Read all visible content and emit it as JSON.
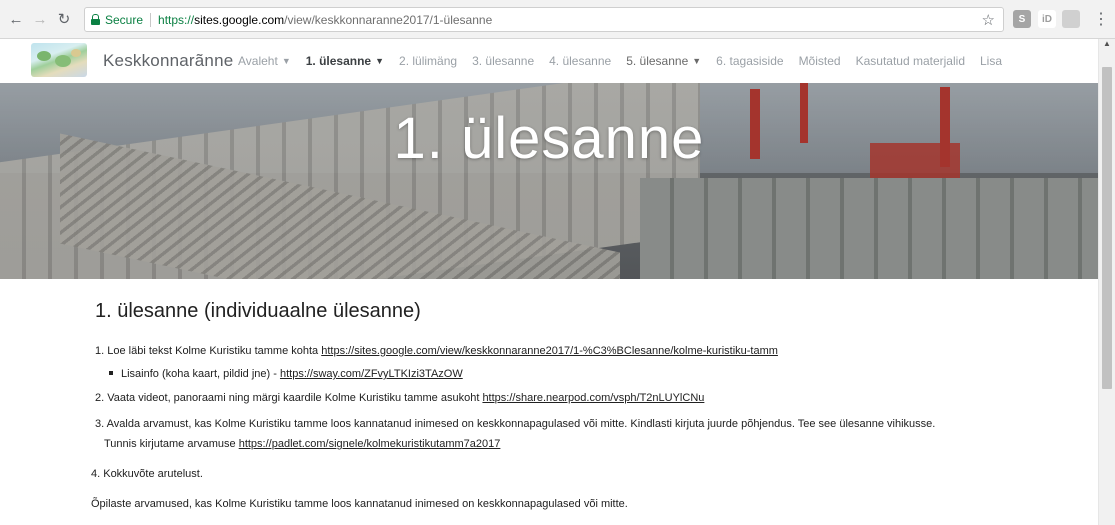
{
  "browser": {
    "secure_label": "Secure",
    "url_https": "https://",
    "url_host": "sites.google.com",
    "url_path": "/view/keskkonnaranne2017/1-ülesanne",
    "extensions": [
      {
        "label": "S",
        "color": "#9e9e9e"
      },
      {
        "label": "iD",
        "color": "#bdbdbd"
      },
      {
        "label": "",
        "color": "#c8c8c8"
      }
    ]
  },
  "site": {
    "title": "Keskkonnarãnne",
    "nav": [
      {
        "label": "Avaleht",
        "dropdown": true,
        "style": "muted"
      },
      {
        "label": "1. ülesanne",
        "dropdown": true,
        "style": "strong"
      },
      {
        "label": "2. lülimäng",
        "dropdown": false,
        "style": "muted"
      },
      {
        "label": "3. ülesanne",
        "dropdown": false,
        "style": "muted"
      },
      {
        "label": "4. ülesanne",
        "dropdown": false,
        "style": "muted"
      },
      {
        "label": "5. ülesanne",
        "dropdown": true,
        "style": "dark"
      },
      {
        "label": "6. tagasiside",
        "dropdown": false,
        "style": "muted"
      },
      {
        "label": "Mõisted",
        "dropdown": false,
        "style": "muted"
      },
      {
        "label": "Kasutatud materjalid",
        "dropdown": false,
        "style": "muted"
      },
      {
        "label": "Lisa",
        "dropdown": false,
        "style": "muted"
      }
    ]
  },
  "banner": {
    "title": "1. ülesanne"
  },
  "content": {
    "heading": "1. ülesanne (individuaalne ülesanne)",
    "item1_text": "1. Loe läbi tekst Kolme Kuristiku tamme kohta ",
    "item1_link": "https://sites.google.com/view/keskkonnaranne2017/1-%C3%BClesanne/kolme-kuristiku-tamm",
    "sub1_text": "Lisainfo (koha kaart, pildid jne) - ",
    "sub1_link": "https://sway.com/ZFvyLTKIzi3TAzOW",
    "item2_text": "2. Vaata videot, panoraami ning märgi kaardile Kolme Kuristiku tamme asukoht ",
    "item2_link": "https://share.nearpod.com/vsph/T2nLUYlCNu",
    "item3_text": "3. Avalda arvamust, kas Kolme Kuristiku tamme loos kannatanud inimesed on keskkonnapagulased või mitte. Kindlasti kirjuta juurde põhjendus. Tee see ülesanne vihikusse.",
    "item3b_text": "Tunnis kirjutame arvamuse ",
    "item3b_link": "https://padlet.com/signele/kolmekuristikutamm7a2017",
    "item4_text": "4. Kokkuvõte arutelust.",
    "footer_text": "Õpilaste arvamused, kas Kolme Kuristiku tamme loos kannatanud inimesed on keskkonnapagulased või mitte."
  }
}
